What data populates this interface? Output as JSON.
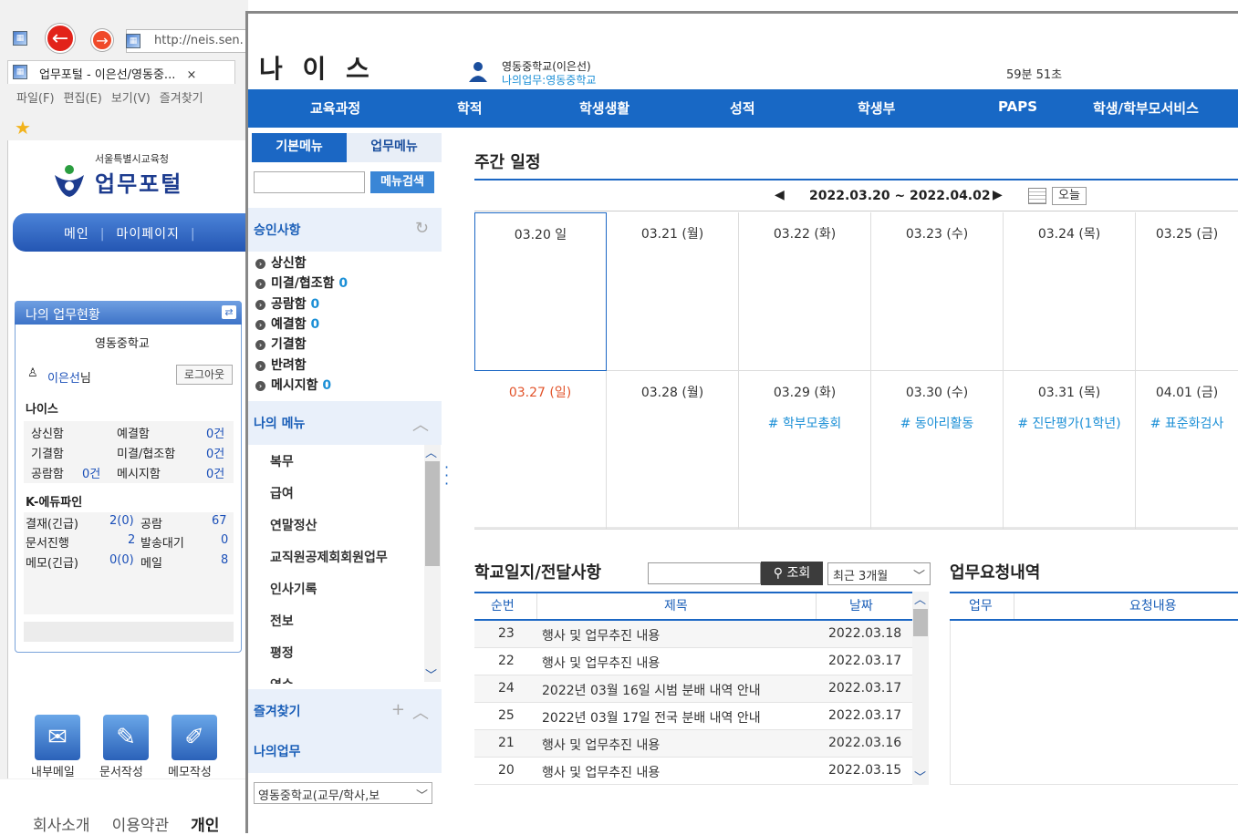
{
  "bg_browser": {
    "url": "http://neis.sen.",
    "tab_title": "업무포털 - 이은선/영동중...",
    "tab_close": "×",
    "menu": [
      "파일(F)",
      "편집(E)",
      "보기(V)",
      "즐겨찾기"
    ],
    "back_icon": "←",
    "forward_icon": "→"
  },
  "portal": {
    "org": "서울특별시교육청",
    "title": "업무포털",
    "nav": [
      "메인",
      "마이페이지"
    ],
    "widget_title": "나의 업무현황",
    "school": "영동중학교",
    "user_name": "이은선",
    "user_suffix": "님",
    "logout": "로그아웃",
    "neis_label": "나이스",
    "neis_rows": [
      [
        "상신함",
        "예결함",
        "0건"
      ],
      [
        "기결함",
        "미결/협조함",
        "0건"
      ],
      [
        "공람함",
        "0건",
        "메시지함",
        "0건"
      ]
    ],
    "kedu_label": "K-에듀파인",
    "kedu_rows": [
      [
        "결재(긴급)",
        "2(0)",
        "공람",
        "67"
      ],
      [
        "문서진행",
        "2",
        "발송대기",
        "0"
      ],
      [
        "메모(긴급)",
        "0(0)",
        "메일",
        "8"
      ]
    ],
    "bottom_icons": [
      "내부메일",
      "문서작성",
      "메모작성"
    ],
    "footer": [
      "회사소개",
      "이용약관",
      "개인"
    ]
  },
  "neis": {
    "brand": "나 이 스",
    "user_line1": "영동중학교(이은선)",
    "user_line2": "나의업무:영동중학교",
    "timer": "59분 51초",
    "top_nav": [
      "교육과정",
      "학적",
      "학생생활",
      "성적",
      "학생부",
      "PAPS",
      "학생/학부모서비스"
    ],
    "tab_basic": "기본메뉴",
    "tab_work": "업무메뉴",
    "menu_search_btn": "메뉴검색",
    "approval_title": "승인사항",
    "approval_items": [
      {
        "label": "상신함",
        "count": ""
      },
      {
        "label": "미결/협조함",
        "count": "0"
      },
      {
        "label": "공람함",
        "count": "0"
      },
      {
        "label": "예결함",
        "count": "0"
      },
      {
        "label": "기결함",
        "count": ""
      },
      {
        "label": "반려함",
        "count": ""
      },
      {
        "label": "메시지함",
        "count": "0"
      }
    ],
    "my_menu_title": "나의 메뉴",
    "my_menu_items": [
      "복무",
      "급여",
      "연말정산",
      "교직원공제회회원업무",
      "인사기록",
      "전보",
      "평정",
      "연수"
    ],
    "favorites_title": "즐겨찾기",
    "favorites_add": "+",
    "my_work_title": "나의업무",
    "bottom_select": "영동중학교(교무/학사,보",
    "schedule": {
      "title": "주간 일정",
      "range": "2022.03.20 ~ 2022.04.02",
      "today": "오늘",
      "week1": [
        "03.20 일",
        "03.21 (월)",
        "03.22 (화)",
        "03.23 (수)",
        "03.24 (목)",
        "03.25 (금)"
      ],
      "week2": [
        "03.27 (일)",
        "03.28 (월)",
        "03.29 (화)",
        "03.30 (수)",
        "03.31 (목)",
        "04.01 (금)"
      ],
      "week2_events": [
        "",
        "",
        "# 학부모총회",
        "# 동아리활동",
        "# 진단평가(1학년)",
        "# 표준화검사"
      ]
    },
    "notice": {
      "title": "학교일지/전달사항",
      "search_btn": "조회",
      "period": "최근 3개월",
      "headers": [
        "순번",
        "제목",
        "날짜"
      ],
      "rows": [
        [
          "23",
          "행사 및 업무추진 내용",
          "2022.03.18"
        ],
        [
          "22",
          "행사 및 업무추진 내용",
          "2022.03.17"
        ],
        [
          "24",
          "2022년 03월 16일 시범 분배 내역 안내",
          "2022.03.17"
        ],
        [
          "25",
          "2022년 03월 17일 전국 분배 내역 안내",
          "2022.03.17"
        ],
        [
          "21",
          "행사 및 업무추진 내용",
          "2022.03.16"
        ],
        [
          "20",
          "행사 및 업무추진 내용",
          "2022.03.15"
        ]
      ]
    },
    "request": {
      "title": "업무요청내역",
      "headers": [
        "업무",
        "요청내용"
      ]
    }
  }
}
